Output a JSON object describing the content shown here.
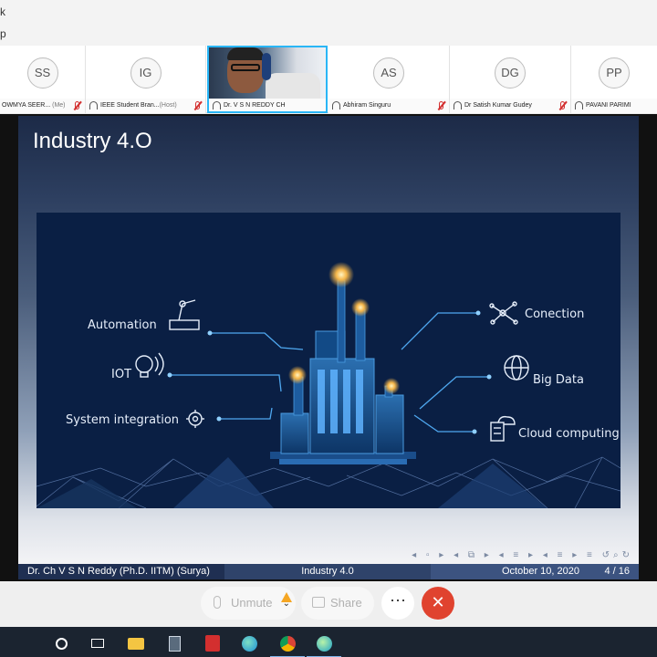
{
  "topbar": {
    "crumb1": "k",
    "crumb2": "p"
  },
  "participants": [
    {
      "initials": "SS",
      "name": "OWMYA SEER...",
      "suffix": "(Me)"
    },
    {
      "initials": "IG",
      "name": "IEEE Student Bran...",
      "suffix": "(Host)"
    },
    {
      "initials": "",
      "name": "Dr. V S N REDDY CH",
      "suffix": ""
    },
    {
      "initials": "AS",
      "name": "Abhiram Singuru",
      "suffix": ""
    },
    {
      "initials": "DG",
      "name": "Dr Satish Kumar Gudey",
      "suffix": ""
    },
    {
      "initials": "PP",
      "name": "PAVANI PARIMI",
      "suffix": ""
    }
  ],
  "slide": {
    "title": "Industry 4.O",
    "labels": {
      "automation": "Automation",
      "iot": "IOT",
      "system_integration": "System integration",
      "connection": "Conection",
      "big_data": "Big Data",
      "cloud": "Cloud computing"
    },
    "footer": {
      "author": "Dr. Ch V S N Reddy (Ph.D. IITM)  (Surya)",
      "topic": "Industry 4.0",
      "date": "October 10, 2020",
      "page": "4 / 16"
    }
  },
  "controls": {
    "unmute": "Unmute",
    "share": "Share",
    "more": "⋯",
    "leave": "✕"
  },
  "taskbar": {
    "icons": [
      "cortana-icon",
      "task-view-icon",
      "file-explorer-icon",
      "calculator-icon",
      "acrobat-icon",
      "edge-icon",
      "chrome-icon",
      "meeting-app-icon"
    ]
  },
  "colors": {
    "accent": "#29b6f6",
    "leave": "#e0432f",
    "warning": "#f5a623",
    "mic_muted": "#d32f2f",
    "slide_dark": "#0a1f44"
  }
}
